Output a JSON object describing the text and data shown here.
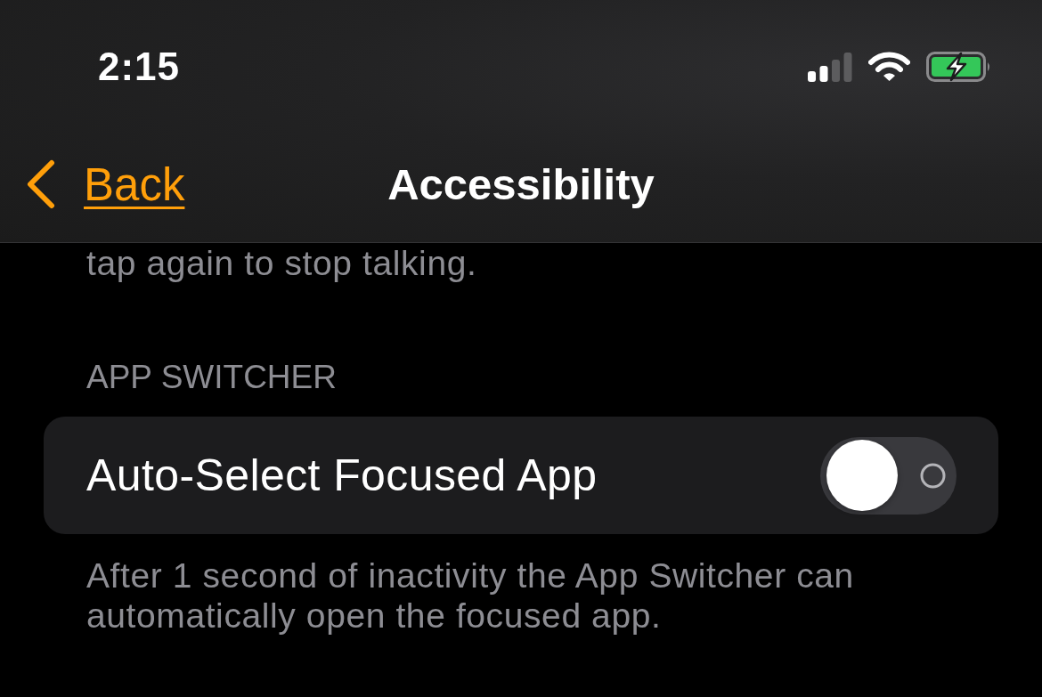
{
  "status_bar": {
    "time": "2:15"
  },
  "nav_bar": {
    "back_label": "Back",
    "title": "Accessibility"
  },
  "previous_footer": "tap again to stop talking.",
  "section": {
    "header": "APP SWITCHER",
    "rows": [
      {
        "kind": "toggle",
        "label": "Auto-Select Focused App",
        "on": false
      }
    ],
    "footer": "After 1 second of inactivity the App Switcher can automatically open the focused app."
  }
}
